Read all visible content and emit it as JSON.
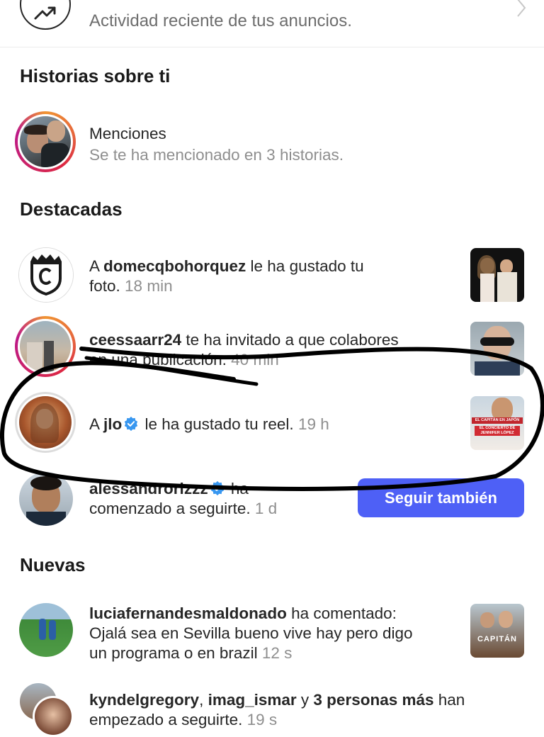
{
  "ads": {
    "text": "Actividad reciente de tus anuncios."
  },
  "sections": {
    "stories_about_you": "Historias sobre ti",
    "featured": "Destacadas",
    "new": "Nuevas"
  },
  "mentions": {
    "title": "Menciones",
    "subtitle": "Se te ha mencionado en 3 historias."
  },
  "featured": [
    {
      "prefix": "A ",
      "user": "domecqbohorquez",
      "action": " le ha gustado tu",
      "line2": "foto.",
      "time": "18 min"
    },
    {
      "user": "ceessaarr24",
      "action": " te ha invitado a que colabores",
      "line2": "en una publicación.",
      "time": "40 min"
    },
    {
      "prefix": "A ",
      "user": "jlo",
      "action": " le ha gustado tu reel.",
      "time": "19 h"
    },
    {
      "user": "alessandrorizzz",
      "action": " ha",
      "line2": "comenzado a seguirte.",
      "time": "1 d"
    }
  ],
  "follow_button": "Seguir también",
  "new": [
    {
      "user": "luciafernandesmaldonado",
      "action": " ha comentado:",
      "line2": "Ojalá sea en Sevilla bueno vive hay pero digo",
      "line3": "un programa o en brazil",
      "time": "12 s"
    },
    {
      "user": "kyndelgregory",
      "sep": ", ",
      "user2": "imag_ismar",
      "and": " y ",
      "others": "3 personas más",
      "action": " han",
      "line2": "empezado a seguirte.",
      "time": "19 s"
    }
  ],
  "thumbs": {
    "jlo_reel_title": "EL CAPITÁN EN JAPÓN",
    "jlo_reel_sub": "EL CONCIERTO DE JENNIFER LÓPEZ",
    "lucia_title": "CAPITÁN"
  },
  "colors": {
    "accent": "#4e60f6",
    "verified": "#3897f0",
    "muted": "#8e8e8e"
  }
}
